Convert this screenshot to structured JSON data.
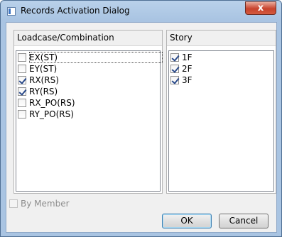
{
  "window": {
    "title": "Records Activation Dialog",
    "close_glyph": "x"
  },
  "loadcase_panel": {
    "header": "Loadcase/Combination",
    "items": [
      {
        "label": "EX(ST)",
        "checked": false,
        "focused": true
      },
      {
        "label": "EY(ST)",
        "checked": false,
        "focused": false
      },
      {
        "label": "RX(RS)",
        "checked": true,
        "focused": false
      },
      {
        "label": "RY(RS)",
        "checked": true,
        "focused": false
      },
      {
        "label": "RX_PO(RS)",
        "checked": false,
        "focused": false
      },
      {
        "label": "RY_PO(RS)",
        "checked": false,
        "focused": false
      }
    ]
  },
  "story_panel": {
    "header": "Story",
    "items": [
      {
        "label": "1F",
        "checked": true
      },
      {
        "label": "2F",
        "checked": true
      },
      {
        "label": "3F",
        "checked": true
      }
    ]
  },
  "by_member": {
    "label": "By Member",
    "checked": false,
    "enabled": false
  },
  "buttons": {
    "ok": "OK",
    "cancel": "Cancel"
  }
}
